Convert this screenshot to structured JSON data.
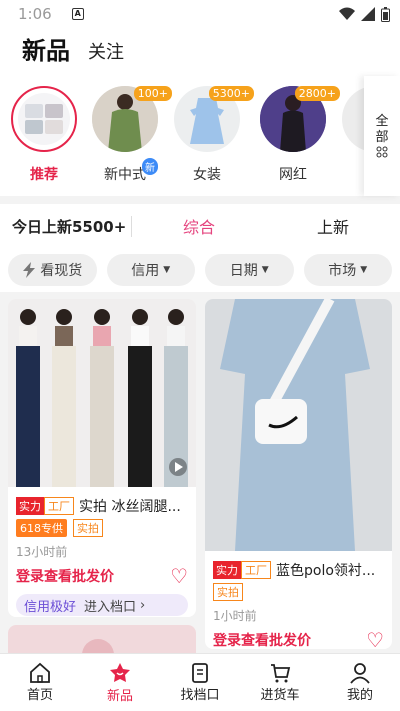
{
  "status": {
    "time": "1:06",
    "sim": "A"
  },
  "header": {
    "active_tab": "新品",
    "tab2": "关注"
  },
  "categories": [
    {
      "label": "推荐",
      "badge": ""
    },
    {
      "label": "新中式",
      "badge": "100+",
      "newtag": "新"
    },
    {
      "label": "女装",
      "badge": "5300+"
    },
    {
      "label": "网红",
      "badge": "2800+"
    }
  ],
  "all_button": {
    "line1": "全",
    "line2": "部"
  },
  "sortbar": {
    "count": "今日上新5500+",
    "opt1": "综合",
    "opt2": "上新"
  },
  "filters": {
    "stock": "看现货",
    "credit": "信用",
    "date": "日期",
    "market": "市场"
  },
  "cards": {
    "c1": {
      "tag1": "实力",
      "tag2": "工厂",
      "title": "实拍 冰丝阔腿...",
      "tag3": "618专供",
      "tag4": "实拍",
      "time": "13小时前",
      "price": "登录查看批发价",
      "credit_label": "信用极好",
      "enter_label": "进入档口"
    },
    "c2": {
      "tag1": "实力",
      "tag2": "工厂",
      "title": "蓝色polo领衬...",
      "tag3": "实拍",
      "time": "1小时前",
      "price": "登录查看批发价"
    }
  },
  "nav": {
    "home": "首页",
    "new": "新品",
    "find": "找档口",
    "cart": "进货车",
    "me": "我的"
  },
  "colors": {
    "accent": "#e5244a",
    "pink_sort": "#e5457f",
    "badge_orange": "#f6a21b"
  }
}
